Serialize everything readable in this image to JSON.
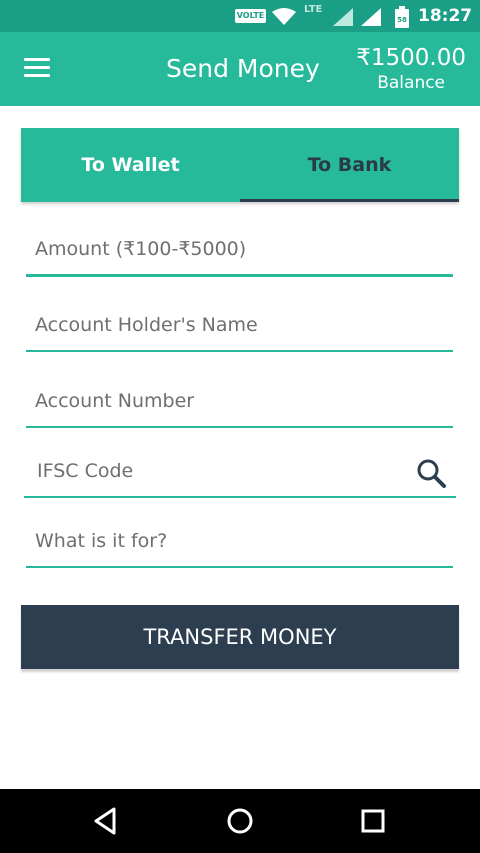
{
  "status_bar": {
    "volte": "VOLTE",
    "network": "LTE",
    "battery": "58",
    "time": "18:27",
    "icons": [
      "wifi-icon",
      "signal-icon",
      "battery-icon"
    ]
  },
  "app_bar": {
    "menu_icon": "hamburger-menu-icon",
    "title": "Send Money",
    "balance_amount": "₹1500.00",
    "balance_label": "Balance"
  },
  "tabs": [
    {
      "label": "To Wallet",
      "selected": false
    },
    {
      "label": "To Bank",
      "selected": true
    }
  ],
  "form": {
    "amount_placeholder": "Amount (₹100-₹5000)",
    "name_placeholder": "Account Holder's Name",
    "account_number_placeholder": "Account Number",
    "ifsc_placeholder": "IFSC Code",
    "ifsc_search_icon": "search-icon",
    "purpose_placeholder": "What is it for?"
  },
  "transfer_button": {
    "label": "TRANSFER MONEY"
  },
  "nav_bar": {
    "icons": [
      "back-icon",
      "home-icon",
      "recents-icon"
    ]
  },
  "colors": {
    "primary": "#26b99a",
    "status_bar": "#1a9f86",
    "dark": "#2c3e50",
    "field_line": "#26b99a"
  }
}
